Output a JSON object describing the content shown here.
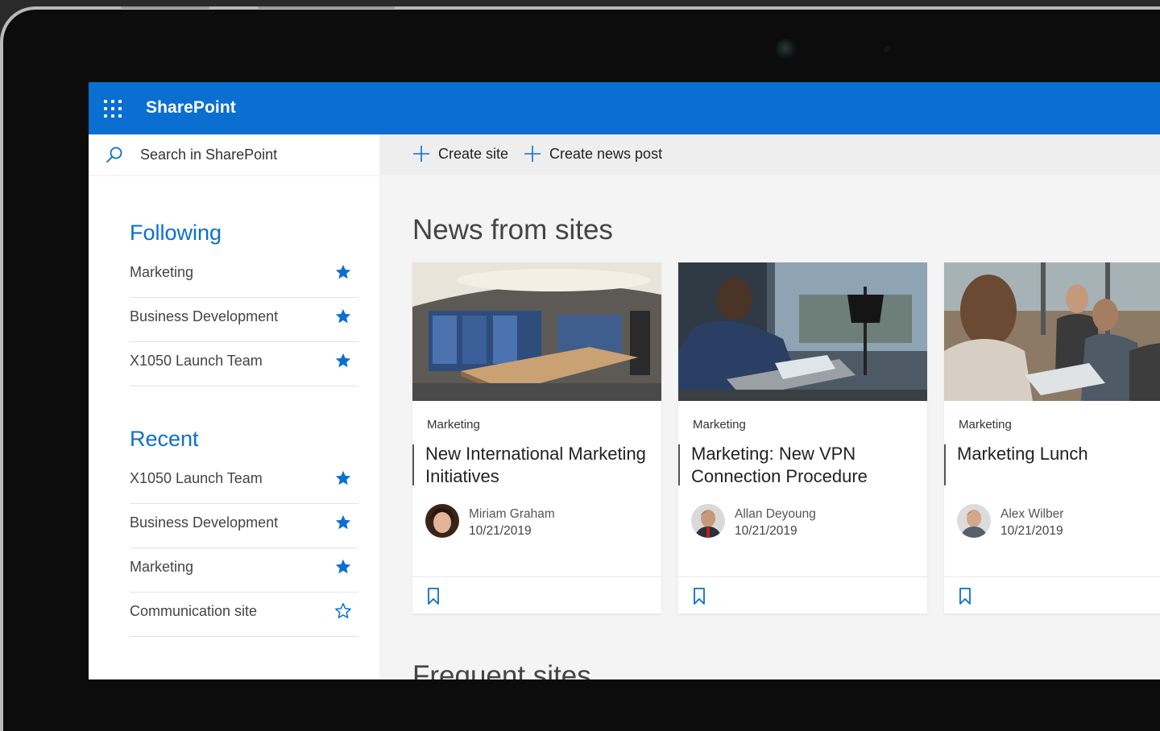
{
  "app": {
    "title": "SharePoint"
  },
  "search": {
    "placeholder": "Search in SharePoint"
  },
  "commands": {
    "create_site": "Create site",
    "create_news": "Create news post"
  },
  "following": {
    "title": "Following",
    "items": [
      {
        "label": "Marketing",
        "starred": true
      },
      {
        "label": "Business Development",
        "starred": true
      },
      {
        "label": "X1050 Launch Team",
        "starred": true
      }
    ]
  },
  "recent": {
    "title": "Recent",
    "items": [
      {
        "label": "X1050 Launch Team",
        "starred": true
      },
      {
        "label": "Business Development",
        "starred": true
      },
      {
        "label": "Marketing",
        "starred": true
      },
      {
        "label": "Communication site",
        "starred": false
      }
    ]
  },
  "news": {
    "title": "News from sites",
    "cards": [
      {
        "site": "Marketing",
        "title": "New International Marketing Initiatives",
        "author": "Miriam Graham",
        "date": "10/21/2019"
      },
      {
        "site": "Marketing",
        "title": "Marketing: New VPN Connection Procedure",
        "author": "Allan Deyoung",
        "date": "10/21/2019"
      },
      {
        "site": "Marketing",
        "title": "Marketing Lunch",
        "author": "Alex Wilber",
        "date": "10/21/2019"
      }
    ]
  },
  "frequent": {
    "title": "Frequent sites"
  },
  "colors": {
    "accent": "#0a6fd1",
    "star": "#0a6fd1"
  }
}
